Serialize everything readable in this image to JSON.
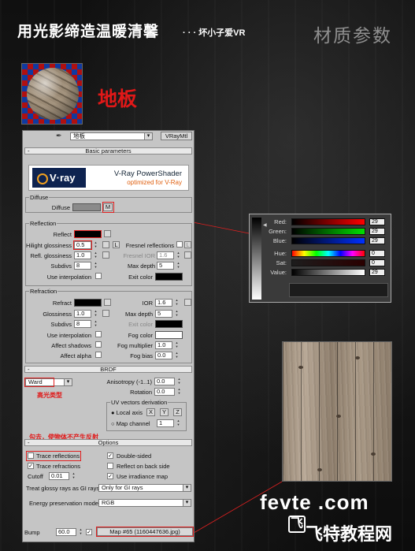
{
  "header": {
    "title": "用光影缔造温暖清馨",
    "subtitle": "· · · 坏小子爱VR",
    "section_title": "材质参数"
  },
  "material_label": "地板",
  "toolbar": {
    "material_name": "地板",
    "material_type": "VRayMtl"
  },
  "basic_parameters": {
    "rollout_label": "Basic parameters",
    "logo": {
      "brand": "V·ray",
      "name": "V-Ray PowerShader",
      "tagline": "optimized for V-Ray"
    },
    "diffuse": {
      "group": "Diffuse",
      "label": "Diffuse",
      "map_button": "M",
      "color": "#8a8a8a"
    },
    "reflection": {
      "group": "Reflection",
      "reflect_label": "Reflect",
      "reflect_color": "#000000",
      "hilight_glossiness_label": "Hilight glossiness",
      "hilight_glossiness": "0.5",
      "lock_button": "L",
      "fresnel_label": "Fresnel reflections",
      "fresnel_lock": "L",
      "refl_glossiness_label": "Refl. glossiness",
      "refl_glossiness": "1.0",
      "fresnel_ior_label": "Fresnel IOR",
      "fresnel_ior": "1.6",
      "subdivs_label": "Subdivs",
      "subdivs": "8",
      "max_depth_label": "Max depth",
      "max_depth": "5",
      "use_interpolation_label": "Use interpolation",
      "exit_color_label": "Exit color",
      "exit_color": "#000000"
    },
    "refraction": {
      "group": "Refraction",
      "refract_label": "Refract",
      "refract_color": "#000000",
      "ior_label": "IOR",
      "ior": "1.6",
      "glossiness_label": "Glossiness",
      "glossiness": "1.0",
      "max_depth_label": "Max depth",
      "max_depth": "5",
      "subdivs_label": "Subdivs",
      "subdivs": "8",
      "exit_color_label": "Exit color",
      "exit_color": "#000000",
      "use_interpolation_label": "Use interpolation",
      "fog_color_label": "Fog color",
      "fog_color": "#ffffff",
      "affect_shadows_label": "Affect shadows",
      "fog_multiplier_label": "Fog multiplier",
      "fog_multiplier": "1.0",
      "affect_alpha_label": "Affect alpha",
      "fog_bias_label": "Fog bias",
      "fog_bias": "0.0"
    }
  },
  "brdf": {
    "rollout_label": "BRDF",
    "type": "Ward",
    "annotation": "高光类型",
    "anisotropy_label": "Anisotropy (-1..1)",
    "anisotropy": "0.0",
    "rotation_label": "Rotation",
    "rotation": "0.0",
    "uv_group": "UV vectors derivation",
    "local_axis_label": "Local axis",
    "axes": [
      "X",
      "Y",
      "Z"
    ],
    "map_channel_label": "Map channel",
    "map_channel": "1"
  },
  "annotation_trace": "勾去，使物体不产生反射",
  "options": {
    "rollout_label": "Options",
    "trace_reflections": {
      "label": "Trace reflections",
      "checked": false
    },
    "double_sided": {
      "label": "Double-sided",
      "checked": true
    },
    "trace_refractions": {
      "label": "Trace refractions",
      "checked": true
    },
    "reflect_on_back_side": {
      "label": "Reflect on back side",
      "checked": false
    },
    "cutoff_label": "Cutoff",
    "cutoff": "0.01",
    "use_irradiance_map": {
      "label": "Use irradiance map",
      "checked": true
    },
    "treat_glossy_label": "Treat glossy rays as GI rays:",
    "treat_glossy_value": "Only for GI rays",
    "energy_label": "Energy preservation mode:",
    "energy_value": "RGB"
  },
  "bump": {
    "label": "Bump",
    "amount": "60.0",
    "checked": true,
    "map_label": "Map #65 (1160447636.jpg)"
  },
  "color_picker": {
    "red_label": "Red:",
    "red": "29",
    "green_label": "Green:",
    "green": "29",
    "blue_label": "Blue:",
    "blue": "29",
    "hue_label": "Hue:",
    "hue": "0",
    "sat_label": "Sat:",
    "sat": "0",
    "value_label": "Value:",
    "value": "29"
  },
  "watermark": {
    "line1": "fevte .com",
    "line2": "飞特教程网"
  },
  "colors": {
    "annotation_red": "#e01818",
    "panel_gray": "#c5c5c5"
  }
}
